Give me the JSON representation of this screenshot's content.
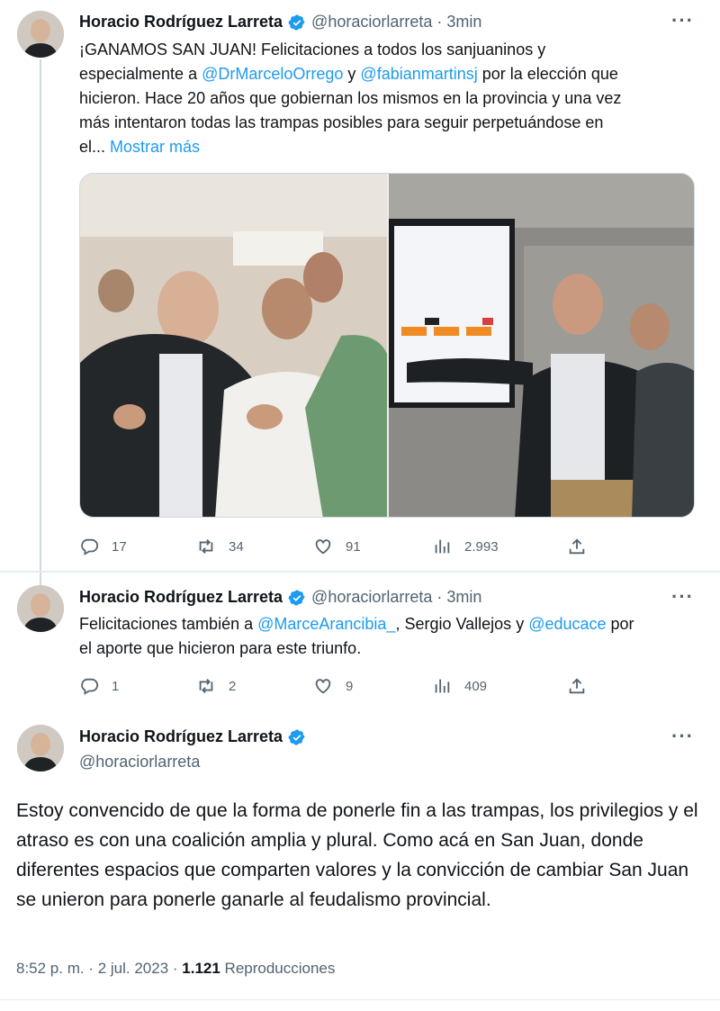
{
  "tweet1": {
    "name": "Horacio Rodríguez Larreta",
    "handle": "@horaciorlarreta",
    "time": "· 3min",
    "text_parts": {
      "l1": "¡GANAMOS SAN JUAN! Felicitaciones a todos los sanjuaninos y",
      "l2a": "especialmente a ",
      "mention1": "@DrMarceloOrrego",
      "l2b": " y ",
      "mention2": "@fabianmartinsj",
      "l2c": " por la elección que",
      "l3": "hicieron. Hace 20 años que gobiernan los mismos en la provincia y una vez",
      "l4": "más intentaron todas las trampas posibles para seguir perpetuándose en",
      "l5": "el... ",
      "show_more": "Mostrar más"
    },
    "replies": "17",
    "retweets": "34",
    "likes": "91",
    "views": "2.993"
  },
  "tweet2": {
    "name": "Horacio Rodríguez Larreta",
    "handle": "@horaciorlarreta",
    "time": "· 3min",
    "text_parts": {
      "l1a": "Felicitaciones también a ",
      "mention1": "@MarceArancibia_",
      "l1b": ", Sergio Vallejos y ",
      "mention2": "@educace",
      "l1c": " por",
      "l2": "el aporte que hicieron para este triunfo."
    },
    "replies": "1",
    "retweets": "2",
    "likes": "9",
    "views": "409"
  },
  "tweet3": {
    "name": "Horacio Rodríguez Larreta",
    "handle": "@horaciorlarreta",
    "text": "Estoy convencido de que la forma de ponerle fin a las trampas, los privilegios y el atraso es con una coalición amplia y plural. Como acá en San Juan, donde diferentes espacios que comparten valores y la convicción de cambiar San Juan se unieron para ponerle ganarle al feudalismo provincial.",
    "timestamp": "8:52 p. m. · 2 jul. 2023 · ",
    "views_count": "1.121",
    "views_label": " Reproducciones"
  },
  "more_icon": "···",
  "colors": {
    "accent": "#1d9bf0",
    "secondary_text": "#536471",
    "primary_text": "#0f1419"
  },
  "icons": [
    "verified-badge-icon",
    "reply-icon",
    "retweet-icon",
    "like-icon",
    "views-icon",
    "share-icon",
    "more-icon"
  ]
}
